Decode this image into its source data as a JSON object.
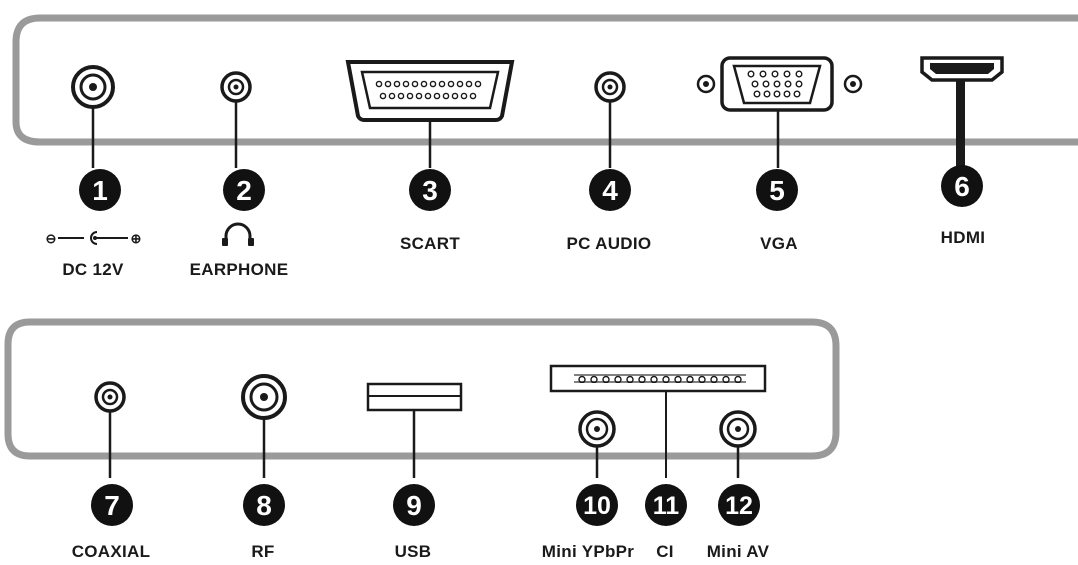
{
  "panels": {
    "top": {
      "ports": [
        {
          "number": "1",
          "label": "DC 12V",
          "polarity_minus": "⊖",
          "polarity_plus": "⊕"
        },
        {
          "number": "2",
          "label": "EARPHONE"
        },
        {
          "number": "3",
          "label": "SCART"
        },
        {
          "number": "4",
          "label": "PC AUDIO"
        },
        {
          "number": "5",
          "label": "VGA"
        },
        {
          "number": "6",
          "label": "HDMI"
        }
      ]
    },
    "bottom": {
      "ports": [
        {
          "number": "7",
          "label": "COAXIAL"
        },
        {
          "number": "8",
          "label": "RF"
        },
        {
          "number": "9",
          "label": "USB"
        },
        {
          "number": "10",
          "label": "Mini YPbPr"
        },
        {
          "number": "11",
          "label": "CI"
        },
        {
          "number": "12",
          "label": "Mini AV"
        }
      ]
    }
  },
  "colors": {
    "panel_stroke": "#9a9a9a",
    "connector": "#1a1a1a",
    "badge": "#111111"
  }
}
